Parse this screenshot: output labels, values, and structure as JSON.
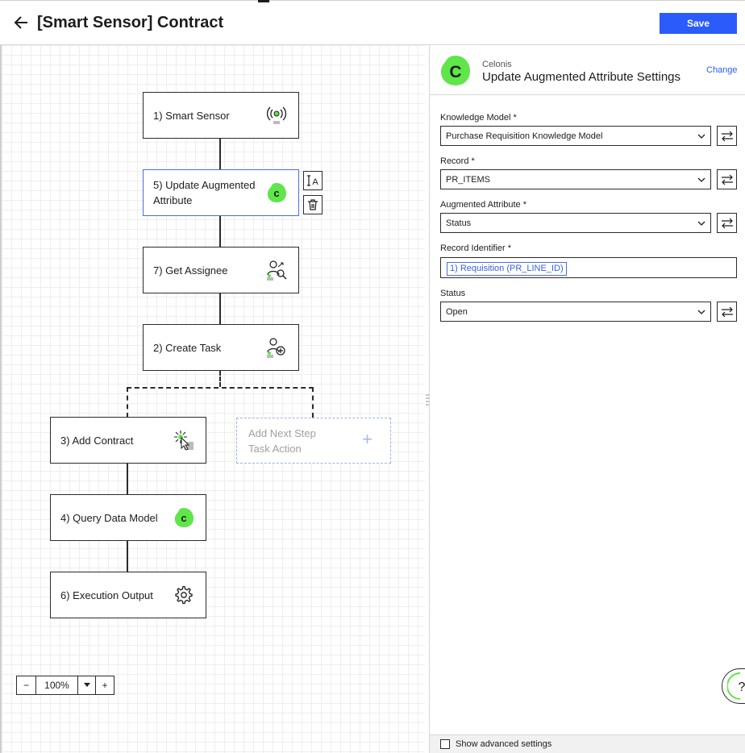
{
  "header": {
    "title": "[Smart Sensor] Contract",
    "save_label": "Save"
  },
  "flow": {
    "nodes": [
      {
        "id": "smart-sensor",
        "label": "1) Smart Sensor",
        "icon": "sensor-icon"
      },
      {
        "id": "update-augmented",
        "label": "5) Update Augmented Attribute",
        "icon": "celonis-logo-icon"
      },
      {
        "id": "get-assignee",
        "label": "7) Get Assignee",
        "icon": "user-search-icon"
      },
      {
        "id": "create-task",
        "label": "2) Create Task",
        "icon": "user-add-icon"
      },
      {
        "id": "add-contract",
        "label": "3) Add Contract",
        "icon": "click-icon"
      },
      {
        "id": "query-data-model",
        "label": "4) Query Data Model",
        "icon": "celonis-logo-icon"
      },
      {
        "id": "execution-output",
        "label": "6) Execution Output",
        "icon": "gear-icon"
      }
    ],
    "add_next_step": {
      "line1": "Add Next Step",
      "line2": "Task Action",
      "plus": "+"
    },
    "zoom": {
      "minus": "−",
      "value": "100%",
      "plus": "+"
    }
  },
  "panel": {
    "provider": "Celonis",
    "title": "Update Augmented Attribute Settings",
    "change_label": "Change",
    "logo_letter": "C",
    "fields": {
      "knowledge_model": {
        "label": "Knowledge Model *",
        "value": "Purchase Requisition Knowledge Model"
      },
      "record": {
        "label": "Record *",
        "value": "PR_ITEMS"
      },
      "augmented_attribute": {
        "label": "Augmented Attribute *",
        "value": "Status"
      },
      "record_identifier": {
        "label": "Record Identifier *",
        "value": "1) Requisition (PR_LINE_ID)"
      },
      "status": {
        "label": "Status",
        "value": "Open"
      }
    },
    "advanced_label": "Show advanced settings",
    "help_label": "?"
  },
  "colors": {
    "accent": "#2b5bfa",
    "celonis_green": "#5fe64a",
    "node_border": "#2b2b2b",
    "selected_border": "#4a6ee0"
  }
}
